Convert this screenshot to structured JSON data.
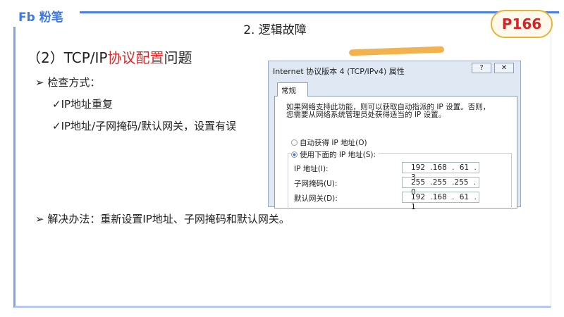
{
  "brand": "粉笔",
  "brand_mark": "Fb",
  "section_title": "2. 逻辑故障",
  "page_badge": "P166",
  "heading": {
    "prefix": "（2）TCP/IP",
    "highlight": "协议配置",
    "suffix": "问题"
  },
  "check": {
    "label": "检查方式：",
    "items": [
      "IP地址重复",
      "IP地址/子网掩码/默认网关，设置有误"
    ]
  },
  "solution": "解决办法：重新设置IP地址、子网掩码和默认网关。",
  "dialog": {
    "title": "Internet 协议版本 4 (TCP/IPv4) 属性",
    "help": "?",
    "close": "✕",
    "tab": "常规",
    "desc1": "如果网络支持此功能，则可以获取自动指派的 IP 设置。否则，",
    "desc2": "您需要从网络系统管理员处获得适当的 IP 设置。",
    "auto": "自动获得 IP 地址(O)",
    "manual": "使用下面的 IP 地址(S):",
    "fields": [
      {
        "label": "IP 地址(I):",
        "value": "192 .168 . 61 . 3"
      },
      {
        "label": "子网掩码(U):",
        "value": "255 .255 .255 . 0"
      },
      {
        "label": "默认网关(D):",
        "value": "192 .168 . 61 . 1"
      }
    ]
  }
}
